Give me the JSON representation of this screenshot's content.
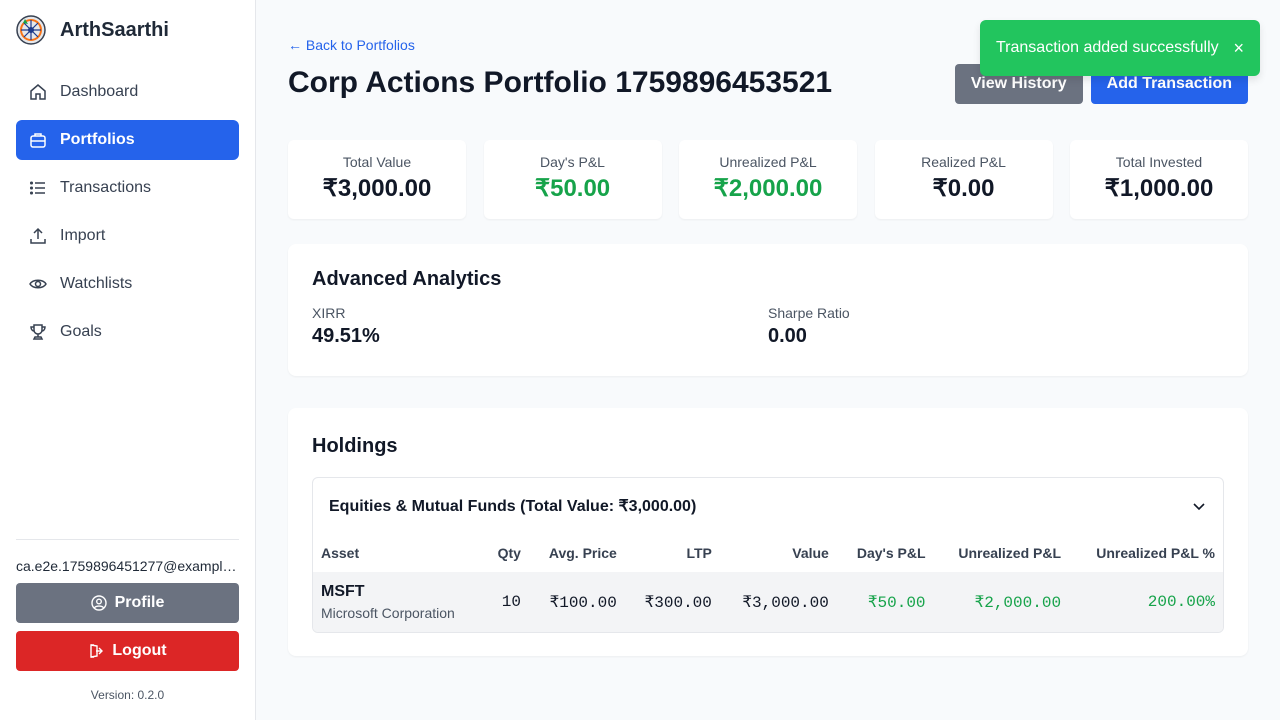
{
  "app": {
    "name": "ArthSaarthi",
    "version": "Version: 0.2.0"
  },
  "sidebar": {
    "items": [
      {
        "label": "Dashboard",
        "icon": "home-icon",
        "active": false
      },
      {
        "label": "Portfolios",
        "icon": "briefcase-icon",
        "active": true
      },
      {
        "label": "Transactions",
        "icon": "list-icon",
        "active": false
      },
      {
        "label": "Import",
        "icon": "upload-icon",
        "active": false
      },
      {
        "label": "Watchlists",
        "icon": "eye-icon",
        "active": false
      },
      {
        "label": "Goals",
        "icon": "trophy-icon",
        "active": false
      }
    ],
    "user_email": "ca.e2e.1759896451277@example.com",
    "profile_label": "Profile",
    "logout_label": "Logout"
  },
  "header": {
    "back_label": "← Back to Portfolios",
    "title": "Corp Actions Portfolio 1759896453521",
    "view_history_label": "View History",
    "add_transaction_label": "Add Transaction"
  },
  "stats": [
    {
      "label": "Total Value",
      "value": "₹3,000.00",
      "positive": false
    },
    {
      "label": "Day's P&L",
      "value": "₹50.00",
      "positive": true
    },
    {
      "label": "Unrealized P&L",
      "value": "₹2,000.00",
      "positive": true
    },
    {
      "label": "Realized P&L",
      "value": "₹0.00",
      "positive": false
    },
    {
      "label": "Total Invested",
      "value": "₹1,000.00",
      "positive": false
    }
  ],
  "analytics": {
    "title": "Advanced Analytics",
    "xirr_label": "XIRR",
    "xirr_value": "49.51%",
    "sharpe_label": "Sharpe Ratio",
    "sharpe_value": "0.00"
  },
  "holdings": {
    "title": "Holdings",
    "group_title": "Equities & Mutual Funds (Total Value: ₹3,000.00)",
    "columns": [
      "Asset",
      "Qty",
      "Avg. Price",
      "LTP",
      "Value",
      "Day's P&L",
      "Unrealized P&L",
      "Unrealized P&L %"
    ],
    "rows": [
      {
        "symbol": "MSFT",
        "name": "Microsoft Corporation",
        "qty": "10",
        "avg_price": "₹100.00",
        "ltp": "₹300.00",
        "value": "₹3,000.00",
        "days_pnl": "₹50.00",
        "unrealized_pnl": "₹2,000.00",
        "unrealized_pct": "200.00%"
      }
    ]
  },
  "toast": {
    "message": "Transaction added successfully",
    "close": "×"
  },
  "colors": {
    "primary": "#2563eb",
    "success": "#16a34a",
    "toast": "#22c55e",
    "danger": "#dc2626",
    "neutral": "#6b7280"
  }
}
